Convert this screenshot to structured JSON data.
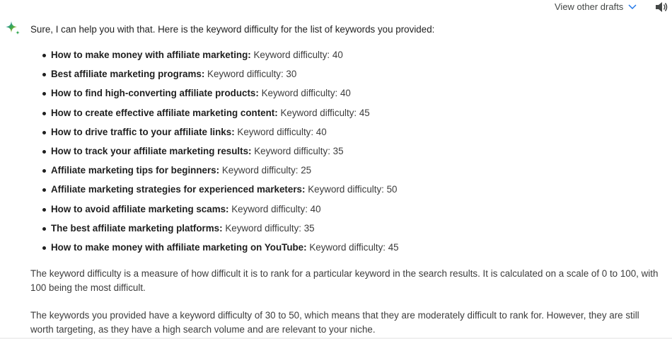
{
  "header": {
    "drafts_label": "View other drafts",
    "drafts_icon": "chevron-down-icon",
    "speaker_icon": "volume-icon"
  },
  "assistant_icon": "sparkle-icon",
  "colors": {
    "sparkle_blue": "#4285f4",
    "sparkle_yellow": "#f4b400",
    "sparkle_green": "#34a853",
    "text": "#1f1f1f"
  },
  "response": {
    "intro": "Sure, I can help you with that. Here is the keyword difficulty for the list of keywords you provided:",
    "keywords": [
      {
        "name": "How to make money with affiliate marketing:",
        "value": "Keyword difficulty: 40"
      },
      {
        "name": "Best affiliate marketing programs:",
        "value": "Keyword difficulty: 30"
      },
      {
        "name": "How to find high-converting affiliate products:",
        "value": "Keyword difficulty: 40"
      },
      {
        "name": "How to create effective affiliate marketing content:",
        "value": "Keyword difficulty: 45"
      },
      {
        "name": "How to drive traffic to your affiliate links:",
        "value": "Keyword difficulty: 40"
      },
      {
        "name": "How to track your affiliate marketing results:",
        "value": "Keyword difficulty: 35"
      },
      {
        "name": "Affiliate marketing tips for beginners:",
        "value": "Keyword difficulty: 25"
      },
      {
        "name": "Affiliate marketing strategies for experienced marketers:",
        "value": "Keyword difficulty: 50"
      },
      {
        "name": "How to avoid affiliate marketing scams:",
        "value": "Keyword difficulty: 40"
      },
      {
        "name": "The best affiliate marketing platforms:",
        "value": "Keyword difficulty: 35"
      },
      {
        "name": "How to make money with affiliate marketing on YouTube:",
        "value": "Keyword difficulty: 45"
      }
    ],
    "paragraph1": "The keyword difficulty is a measure of how difficult it is to rank for a particular keyword in the search results. It is calculated on a scale of 0 to 100, with 100 being the most difficult.",
    "paragraph2": "The keywords you provided have a keyword difficulty of 30 to 50, which means that they are moderately difficult to rank for. However, they are still worth targeting, as they have a high search volume and are relevant to your niche."
  }
}
